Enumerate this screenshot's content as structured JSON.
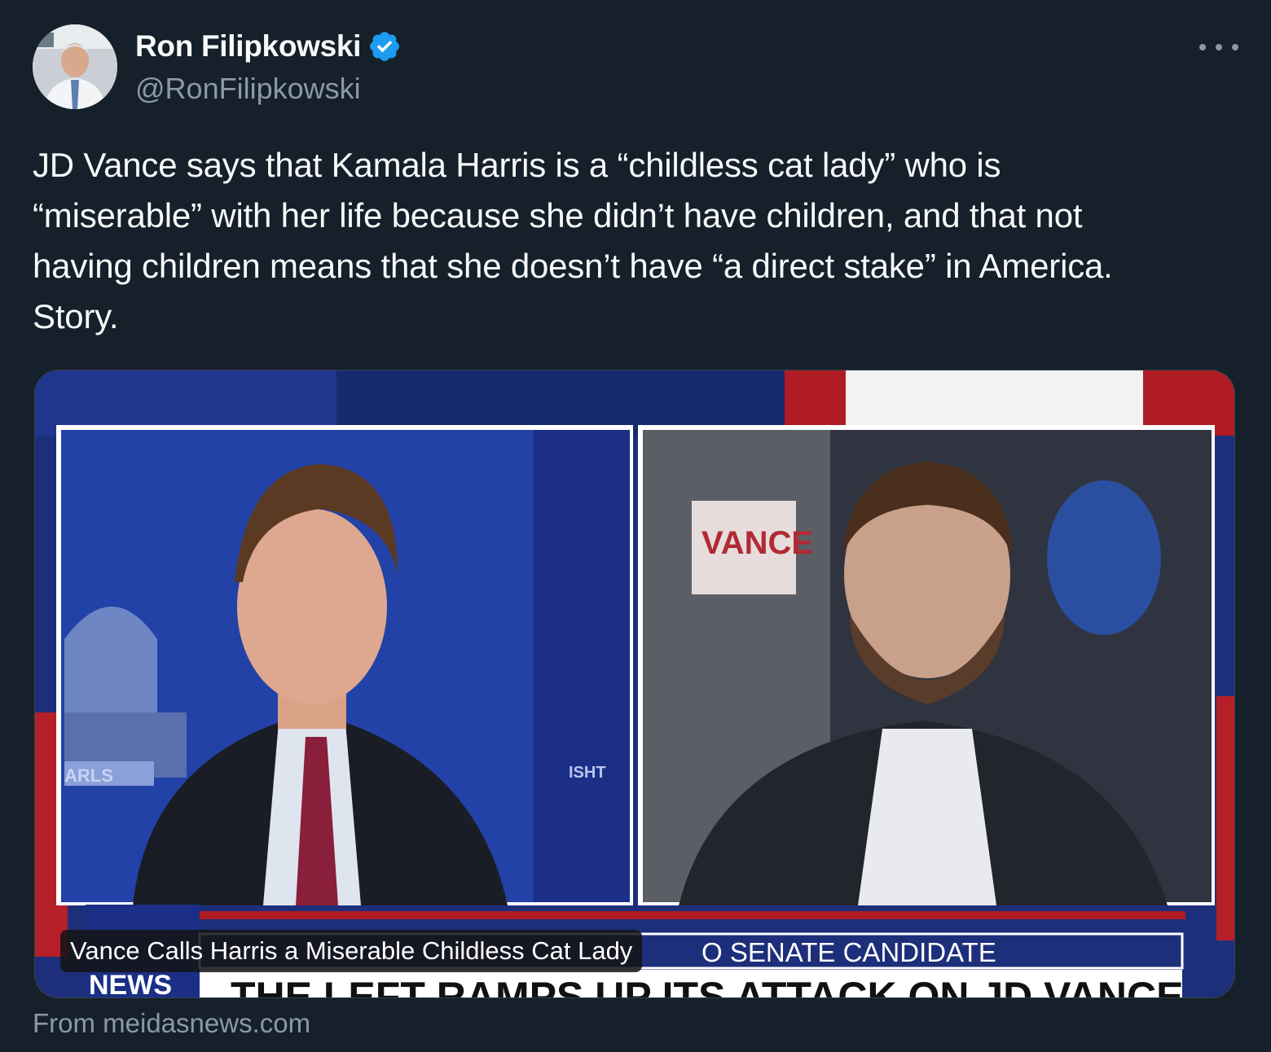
{
  "author": {
    "name": "Ron Filipkowski",
    "handle": "@RonFilipkowski",
    "verified": true
  },
  "tweet": {
    "text": "JD Vance says that Kamala Harris is a “childless cat lady” who is\n“miserable” with her life because she didn’t have children, and that not\nhaving children means that she doesn’t have “a direct stake” in America.\nStory."
  },
  "media": {
    "caption": "Vance Calls Harris a Miserable Childless Cat Lady",
    "chyron_top": "O SENATE CANDIDATE",
    "chyron_bottom": "THE LEFT RAMPS UP ITS ATTACK ON JD VANCE",
    "logo_text": "NEWS",
    "sign_text": "VANCE"
  },
  "link_source": "From meidasnews.com",
  "colors": {
    "background": "#15202b",
    "verified_blue": "#1d9bf0",
    "secondary_text": "#8b98a5"
  },
  "icons": {
    "verified": "verified-badge-icon",
    "more": "more-options-icon"
  }
}
